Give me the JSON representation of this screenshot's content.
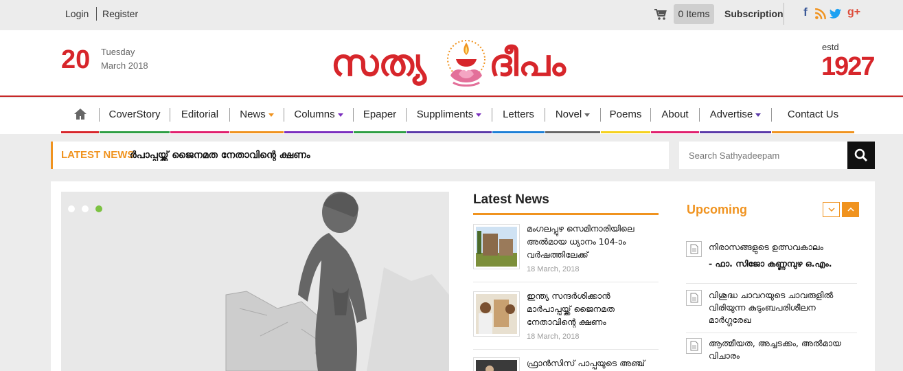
{
  "topbar": {
    "login": "Login",
    "register": "Register",
    "cart_items": "0 Items",
    "subscription": "Subscription",
    "social": [
      {
        "icon": "facebook-icon",
        "glyph": "f",
        "color": "#3b5998"
      },
      {
        "icon": "rss-icon",
        "glyph": "◉",
        "color": "#f0931f"
      },
      {
        "icon": "twitter-icon",
        "glyph": "t",
        "color": "#1da1f2"
      },
      {
        "icon": "google-plus-icon",
        "glyph": "g+",
        "color": "#dd4b39"
      }
    ]
  },
  "header": {
    "day": "20",
    "weekday": "Tuesday",
    "month_year": "March 2018",
    "logo_left": "സത്യ",
    "logo_right": "ദീപം",
    "estd_label": "estd",
    "estd_year": "1927"
  },
  "nav": {
    "items": [
      {
        "label": "",
        "icon": "home-icon",
        "color": "#d7262b"
      },
      {
        "label": "CoverStory",
        "color": "#2e9e44"
      },
      {
        "label": "Editorial",
        "color": "#e0206e"
      },
      {
        "label": "News",
        "caret": true,
        "caret_color": "#f0931f",
        "color": "#f0931f"
      },
      {
        "label": "Columns",
        "caret": true,
        "caret_color": "#7b2fbe",
        "color": "#7b2fbe"
      },
      {
        "label": "Epaper",
        "color": "#2e9e44"
      },
      {
        "label": "Suppliments",
        "caret": true,
        "caret_color": "#7b2fbe",
        "color": "#5b3aa8"
      },
      {
        "label": "Letters",
        "color": "#1d7fd6"
      },
      {
        "label": "Novel",
        "caret": true,
        "caret_color": "#666",
        "color": "#666"
      },
      {
        "label": "Poems",
        "color": "#f5d11e"
      },
      {
        "label": "About",
        "color": "#e0206e"
      },
      {
        "label": "Advertise",
        "caret": true,
        "caret_color": "#5b3aa8",
        "color": "#5b3aa8"
      },
      {
        "label": "Contact Us",
        "color": "#f0931f"
      }
    ]
  },
  "ticker": {
    "label": "LATEST NEWS",
    "text": "ർപാപ്പയ്ക്ക് ജൈനമത നേതാവിന്റെ ക്ഷണം"
  },
  "search": {
    "placeholder": "Search Sathyadeepam"
  },
  "slider": {
    "active_dot": 2,
    "dot_count": 3
  },
  "latest_news": {
    "title": "Latest News",
    "items": [
      {
        "title": "മംഗലപ്പുഴ സെമിനാരിയിലെ അല്‍മായ ധ്യാനം 104-ാം വര്‍ഷത്തിലേക്ക്",
        "date": "18 March, 2018"
      },
      {
        "title": "ഇന്ത്യ സന്ദര്‍ശിക്കാന്‍ മാര്‍പാപ്പയ്ക്ക് ജൈനമത നേതാവിന്റെ ക്ഷണം",
        "date": "18 March, 2018"
      },
      {
        "title": "ഫ്രാന്‍സിസ് പാപ്പയുടെ അഞ്ച്",
        "date": ""
      }
    ]
  },
  "upcoming": {
    "title": "Upcoming",
    "items": [
      {
        "title": "നിരാസങ്ങളുടെ ഉത്സവകാലം",
        "author": "- ഫാ. സിജോ കണ്ണമ്പുഴ ഒ.എം."
      },
      {
        "title": "വിശുദ്ധ ചാവറയുടെ ചാവരുളില്‍ വിരിയുന്ന കുടുംബപരിശീലന മാര്‍ഗ്ഗരേഖ",
        "author": ""
      },
      {
        "title": "ആത്മീയത, അച്ചടക്കം, അല്‍മായ വിചാരം",
        "author": ""
      }
    ]
  }
}
